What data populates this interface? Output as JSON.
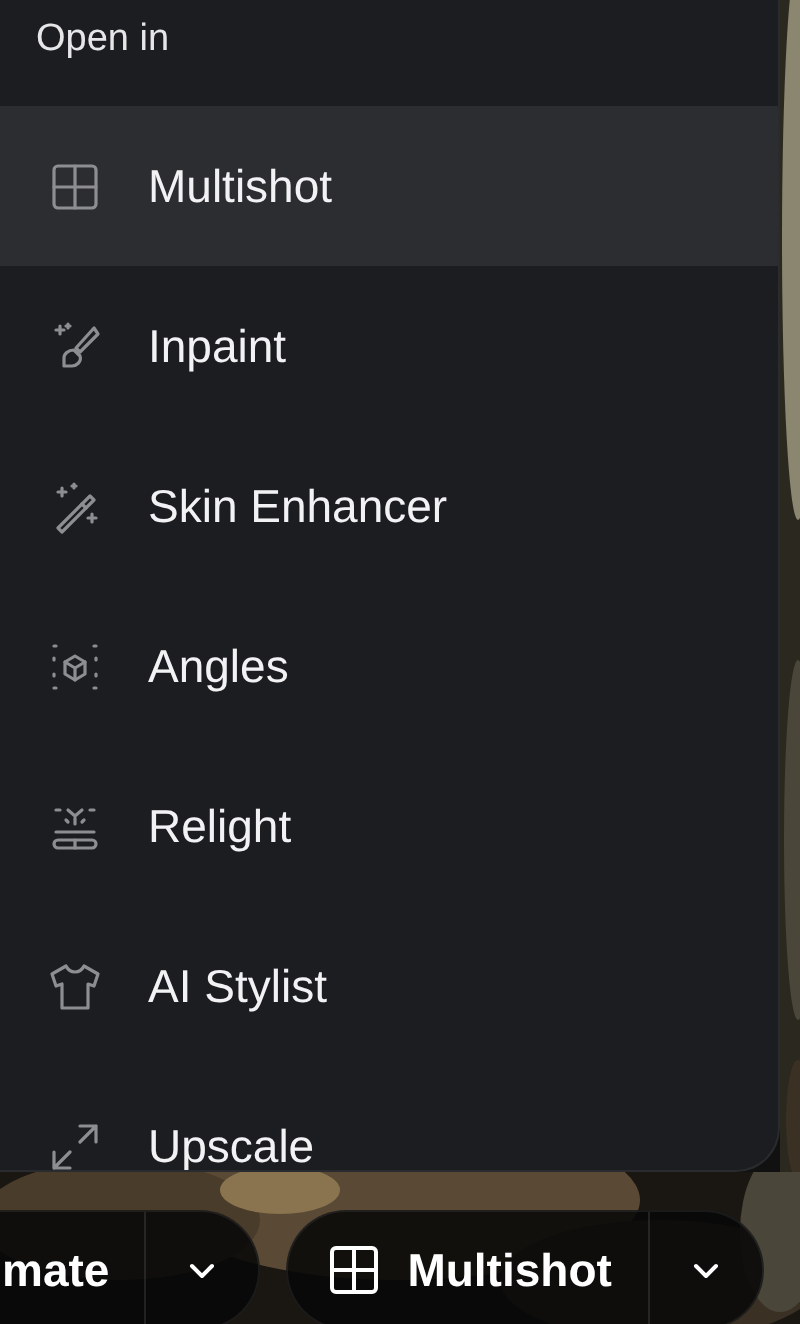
{
  "menu": {
    "header": "Open in",
    "items": [
      {
        "label": "Multishot",
        "selected": true
      },
      {
        "label": "Inpaint",
        "selected": false
      },
      {
        "label": "Skin Enhancer",
        "selected": false
      },
      {
        "label": "Angles",
        "selected": false
      },
      {
        "label": "Relight",
        "selected": false
      },
      {
        "label": "AI Stylist",
        "selected": false
      },
      {
        "label": "Upscale",
        "selected": false
      }
    ]
  },
  "actions": [
    {
      "label": "mate",
      "has_icon": false
    },
    {
      "label": "Multishot",
      "has_icon": true
    }
  ]
}
